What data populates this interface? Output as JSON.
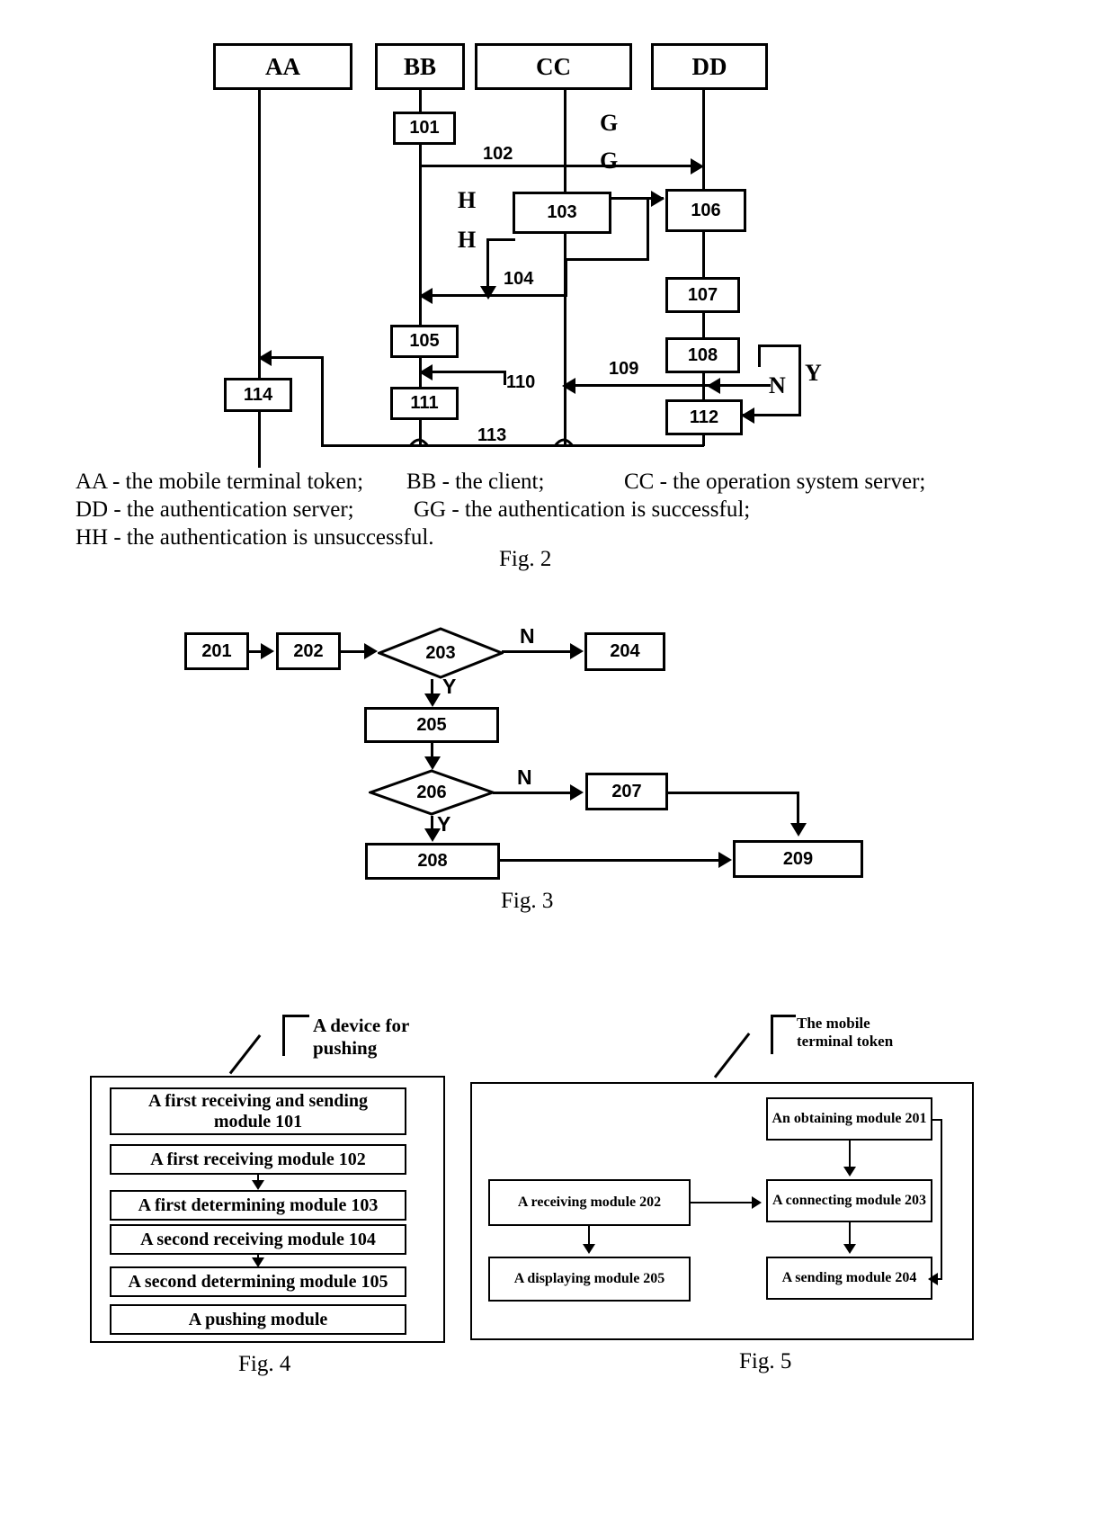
{
  "fig2": {
    "caption": "Fig. 2",
    "lanes": [
      {
        "id": "AA",
        "label": "AA"
      },
      {
        "id": "BB",
        "label": "BB"
      },
      {
        "id": "CC",
        "label": "CC"
      },
      {
        "id": "DD",
        "label": "DD"
      }
    ],
    "steps": [
      "101",
      "102",
      "103",
      "104",
      "105",
      "106",
      "107",
      "108",
      "109",
      "110",
      "111",
      "112",
      "113",
      "114"
    ],
    "branch_glyphs": {
      "g1": "G",
      "g2": "G",
      "h1": "H",
      "h2": "H",
      "n": "N",
      "y": "Y"
    },
    "legend": [
      "AA - the mobile terminal token;",
      "BB - the client;",
      "CC - the operation system server;",
      "DD - the authentication server;",
      "GG - the authentication is successful;",
      "HH - the authentication is unsuccessful."
    ]
  },
  "fig3": {
    "caption": "Fig. 3",
    "nodes": {
      "n201": "201",
      "n202": "202",
      "n203": "203",
      "n204": "204",
      "n205": "205",
      "n206": "206",
      "n207": "207",
      "n208": "208",
      "n209": "209"
    },
    "edge_labels": {
      "n203_no": "N",
      "n203_yes": "Y",
      "n206_no": "N",
      "n206_yes": "Y"
    }
  },
  "fig4": {
    "caption": "Fig. 4",
    "title": "A device for\npushing",
    "modules": [
      "A first receiving and sending\nmodule 101",
      "A first receiving module 102",
      "A first determining module 103",
      "A second receiving module 104",
      "A second determining module 105",
      "A pushing module"
    ]
  },
  "fig5": {
    "caption": "Fig. 5",
    "title": "The mobile\nterminal token",
    "modules": {
      "obtaining": "An obtaining module 201",
      "receiving": "A receiving module 202",
      "connecting": "A connecting module 203",
      "displaying": "A displaying module 205",
      "sending": "A sending module 204"
    }
  }
}
